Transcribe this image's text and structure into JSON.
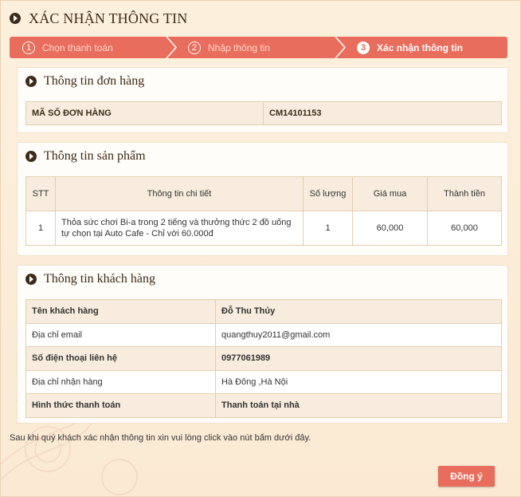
{
  "page": {
    "title": "XÁC NHẬN THÔNG TIN"
  },
  "steps": [
    {
      "number": "1",
      "label": "Chọn thanh toán",
      "state": "done"
    },
    {
      "number": "2",
      "label": "Nhập thông tin",
      "state": "done"
    },
    {
      "number": "3",
      "label": "Xác nhận thông tin",
      "state": "active"
    }
  ],
  "order": {
    "heading": "Thông tin đơn hàng",
    "code_label": "MÃ SỐ ĐƠN HÀNG",
    "code_value": "CM14101153"
  },
  "product": {
    "heading": "Thông tin sản phẩm",
    "columns": [
      "STT",
      "Thông tin chi tiết",
      "Số lượng",
      "Giá mua",
      "Thành tiền"
    ],
    "rows": [
      {
        "stt": "1",
        "detail": "Thỏa sức chơi Bi-a trong 2 tiếng và thưởng thức 2 đồ uống tự chọn tại Auto Cafe - Chỉ với 60.000đ",
        "qty": "1",
        "price": "60,000",
        "total": "60,000"
      }
    ]
  },
  "customer": {
    "heading": "Thông tin khách hàng",
    "rows": [
      {
        "label": "Tên khách hàng",
        "value": "Đỗ Thu Thủy"
      },
      {
        "label": "Địa chỉ email",
        "value": "quangthuy2011@gmail.com"
      },
      {
        "label": "Số điện thoại liên hệ",
        "value": "0977061989"
      },
      {
        "label": "Địa chỉ nhận hàng",
        "value": "Hà Đông ,Hà Nội"
      },
      {
        "label": "Hình thức thanh toán",
        "value": "Thanh toán tại nhà"
      }
    ]
  },
  "note": "Sau khi quý khách xác nhận thông tin xin vui lòng click vào nút bấm dưới đây.",
  "buttons": {
    "confirm": "Đồng ý"
  },
  "colors": {
    "accent": "#e96d5c",
    "background": "#fbecd6",
    "cell": "#f7ecdd",
    "border": "#e2cfae",
    "heading": "#3d2a1a"
  }
}
